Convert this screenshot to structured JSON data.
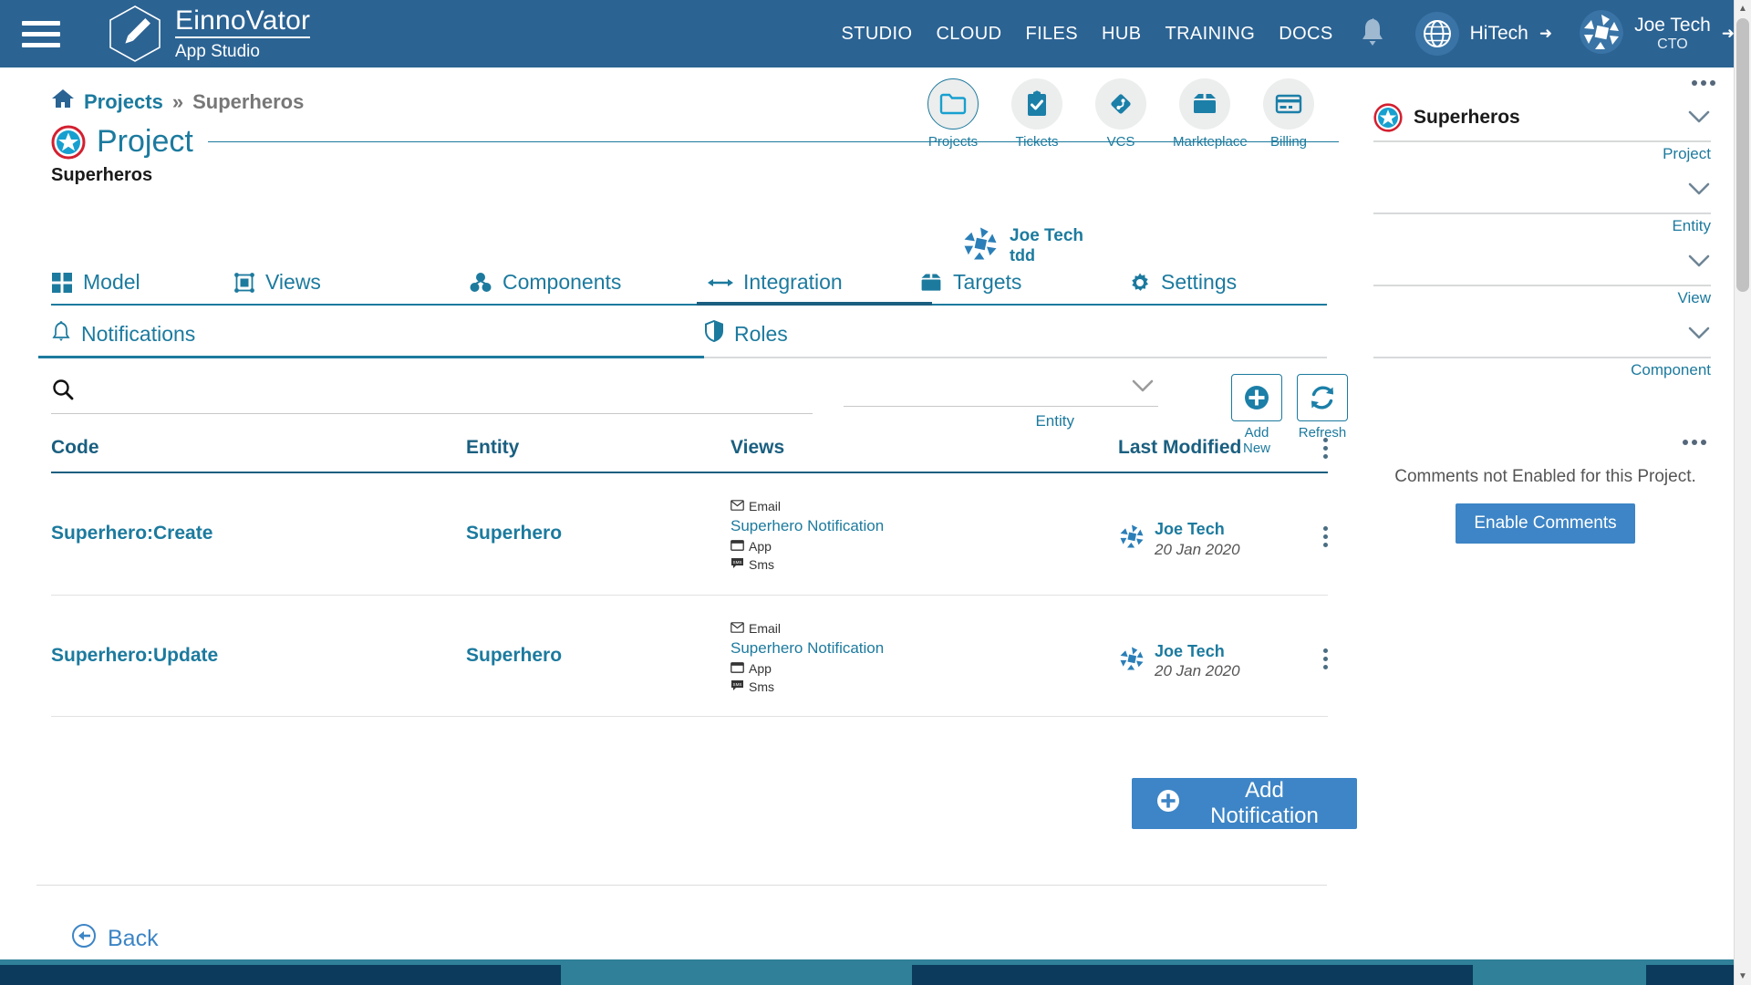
{
  "header": {
    "menu_icon": "hamburger-icon",
    "logo_icon": "pencil-hexagon-icon",
    "brand_title": "EinnoVator",
    "brand_subtitle": "App Studio",
    "nav": [
      {
        "label": "STUDIO"
      },
      {
        "label": "CLOUD"
      },
      {
        "label": "FILES"
      },
      {
        "label": "HUB"
      },
      {
        "label": "TRAINING"
      },
      {
        "label": "DOCS"
      }
    ],
    "bell_icon": "notification-bell-icon",
    "org": {
      "icon": "globe-icon",
      "name": "HiTech",
      "caret": "chevron-down-icon"
    },
    "user": {
      "avatar": "user-avatar",
      "name": "Joe Tech",
      "role": "CTO",
      "caret": "chevron-down-icon"
    }
  },
  "breadcrumb": {
    "home_icon": "home-icon",
    "root": "Projects",
    "separator": "»",
    "current": "Superheros"
  },
  "page": {
    "icon": "project-star-icon",
    "title": "Project",
    "subtitle": "Superheros",
    "owner": {
      "name": "Joe Tech",
      "org": "tdd"
    }
  },
  "icon_nav": [
    {
      "icon": "folder-icon",
      "label": "Projects",
      "active": true
    },
    {
      "icon": "clipboard-check-icon",
      "label": "Tickets",
      "active": false
    },
    {
      "icon": "git-branch-icon",
      "label": "VCS",
      "active": false
    },
    {
      "icon": "box-icon",
      "label": "Markteplace",
      "active": false
    },
    {
      "icon": "credit-card-icon",
      "label": "Billing",
      "active": false
    }
  ],
  "tabs": [
    {
      "icon": "grid-icon",
      "label": "Model",
      "active": false
    },
    {
      "icon": "view-frame-icon",
      "label": "Views",
      "active": false
    },
    {
      "icon": "components-icon",
      "label": "Components",
      "active": false
    },
    {
      "icon": "arrows-horizontal-icon",
      "label": "Integration",
      "active": true
    },
    {
      "icon": "box-icon",
      "label": "Targets",
      "active": false
    },
    {
      "icon": "gear-icon",
      "label": "Settings",
      "active": false
    }
  ],
  "subtabs": [
    {
      "icon": "bell-outline-icon",
      "label": "Notifications",
      "active": true
    },
    {
      "icon": "shield-icon",
      "label": "Roles",
      "active": false
    }
  ],
  "toolbar": {
    "search": {
      "icon": "search-icon",
      "value": "",
      "placeholder": ""
    },
    "entity_filter": {
      "value": "",
      "label": "Entity",
      "caret": "chevron-down-icon"
    },
    "add_new": {
      "icon": "plus-circle-icon",
      "label": "Add New"
    },
    "refresh": {
      "icon": "refresh-icon",
      "label": "Refresh"
    }
  },
  "table": {
    "columns": [
      "Code",
      "Entity",
      "Views",
      "Last Modified"
    ],
    "menu_icon": "kebab-menu-icon",
    "rows": [
      {
        "code": "Superhero:Create",
        "entity": "Superhero",
        "views": [
          {
            "icon": "email-icon",
            "channel": "Email"
          },
          {
            "link": "Superhero Notification"
          },
          {
            "icon": "app-window-icon",
            "channel": "App"
          },
          {
            "icon": "sms-icon",
            "channel": "Sms"
          }
        ],
        "modified_by": "Joe Tech",
        "modified_at": "20 Jan 2020"
      },
      {
        "code": "Superhero:Update",
        "entity": "Superhero",
        "views": [
          {
            "icon": "email-icon",
            "channel": "Email"
          },
          {
            "link": "Superhero Notification"
          },
          {
            "icon": "app-window-icon",
            "channel": "App"
          },
          {
            "icon": "sms-icon",
            "channel": "Sms"
          }
        ],
        "modified_by": "Joe Tech",
        "modified_at": "20 Jan 2020"
      }
    ]
  },
  "actions": {
    "add_notification": "Add Notification",
    "back": "Back"
  },
  "right_panel": {
    "more_icon": "more-options-icon",
    "fields": [
      {
        "icon": "project-star-icon",
        "value": "Superheros",
        "label": "Project"
      },
      {
        "icon": "",
        "value": "",
        "label": "Entity"
      },
      {
        "icon": "",
        "value": "",
        "label": "View"
      },
      {
        "icon": "",
        "value": "",
        "label": "Component"
      }
    ],
    "comments": {
      "more_icon": "more-options-icon",
      "message": "Comments not Enabled for this Project.",
      "button": "Enable Comments"
    }
  },
  "colors": {
    "header_blue": "#2b6393",
    "accent_teal": "#1c7a9e",
    "dark_teal": "#1a5f80",
    "button_blue": "#3d85c6",
    "bottom_dark": "#0b3a5d",
    "bottom_teal": "#2f8098"
  }
}
